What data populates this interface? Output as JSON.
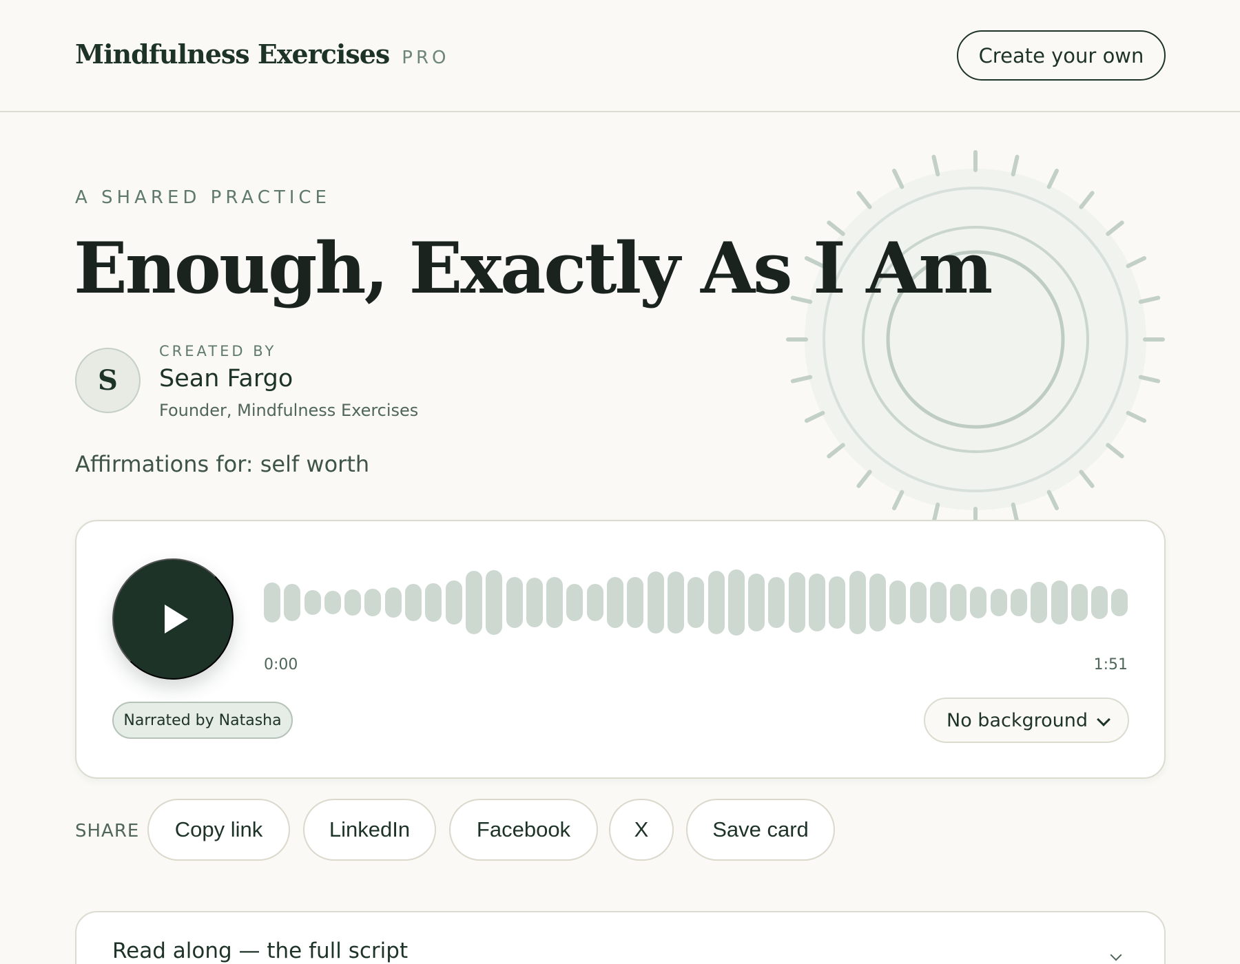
{
  "header": {
    "brand_name": "Mindfulness Exercises",
    "brand_tier": "PRO",
    "create_button": "Create your own"
  },
  "hero": {
    "eyebrow": "A SHARED PRACTICE",
    "title": "Enough, Exactly As I Am",
    "creator": {
      "label": "CREATED BY",
      "initial": "S",
      "name": "Sean Fargo",
      "role": "Founder, Mindfulness Exercises"
    },
    "affirmations_for": "Affirmations for: self worth"
  },
  "player": {
    "play_icon": "play-icon",
    "progress": 0,
    "time_current": "0:00",
    "time_total": "1:51",
    "narrator": "Narrated by Natasha",
    "background_select": "No background"
  },
  "share": {
    "label": "SHARE",
    "buttons": [
      "Copy link",
      "LinkedIn",
      "Facebook",
      "X",
      "Save card"
    ]
  },
  "readalong": {
    "label": "Read along — the full script"
  },
  "colors": {
    "primary": "#1e3328",
    "background": "#faf9f5",
    "muted": "#5f7a6a",
    "wave": "#cdd8d1",
    "sun": "#c3d0c7"
  }
}
